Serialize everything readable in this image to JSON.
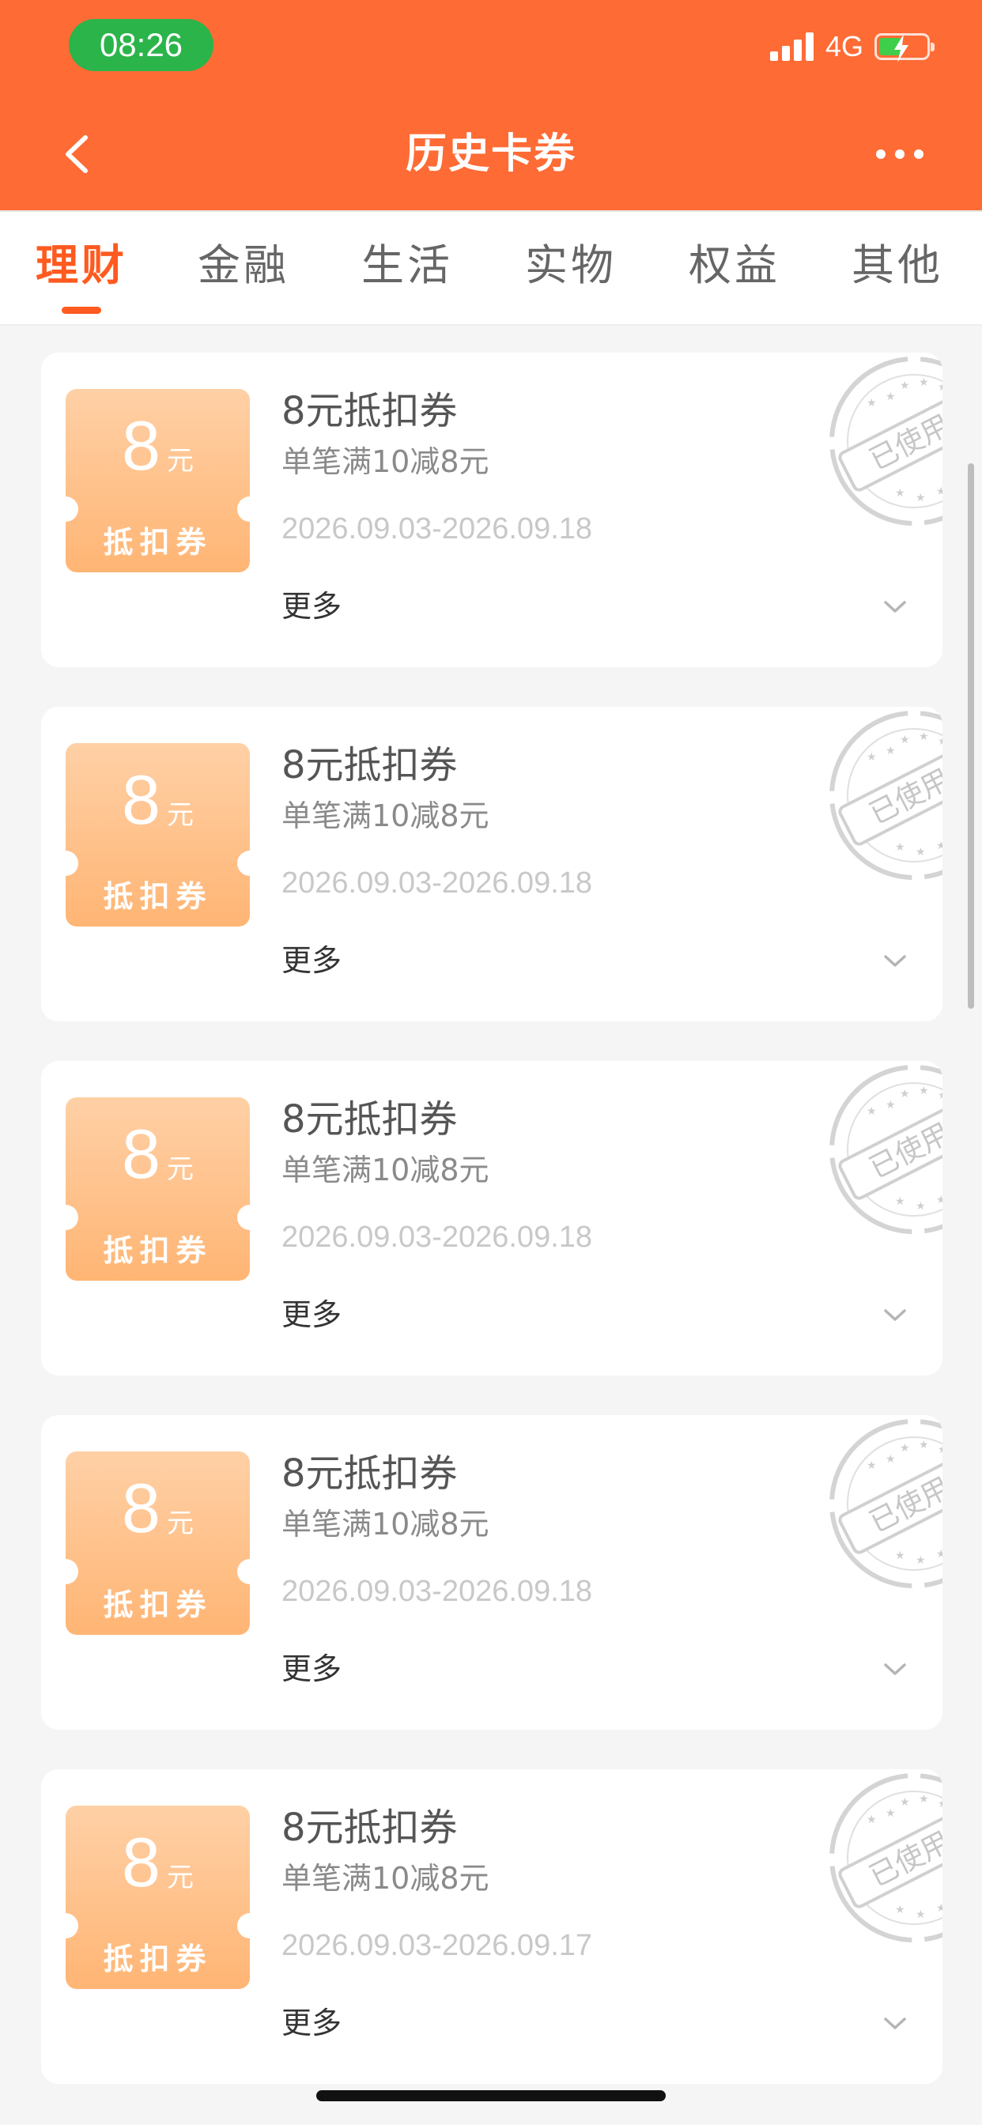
{
  "status_bar": {
    "time": "08:26",
    "network": "4G"
  },
  "header": {
    "title": "历史卡券"
  },
  "tabs": [
    {
      "label": "理财",
      "active": true
    },
    {
      "label": "金融",
      "active": false
    },
    {
      "label": "生活",
      "active": false
    },
    {
      "label": "实物",
      "active": false
    },
    {
      "label": "权益",
      "active": false
    },
    {
      "label": "其他",
      "active": false
    }
  ],
  "coupons": [
    {
      "amount": "8",
      "unit": "元",
      "kind": "抵扣券",
      "title": "8元抵扣券",
      "rule": "单笔满10减8元",
      "validity": "2026.09.03-2026.09.18",
      "more": "更多",
      "stamp": "已使用"
    },
    {
      "amount": "8",
      "unit": "元",
      "kind": "抵扣券",
      "title": "8元抵扣券",
      "rule": "单笔满10减8元",
      "validity": "2026.09.03-2026.09.18",
      "more": "更多",
      "stamp": "已使用"
    },
    {
      "amount": "8",
      "unit": "元",
      "kind": "抵扣券",
      "title": "8元抵扣券",
      "rule": "单笔满10减8元",
      "validity": "2026.09.03-2026.09.18",
      "more": "更多",
      "stamp": "已使用"
    },
    {
      "amount": "8",
      "unit": "元",
      "kind": "抵扣券",
      "title": "8元抵扣券",
      "rule": "单笔满10减8元",
      "validity": "2026.09.03-2026.09.18",
      "more": "更多",
      "stamp": "已使用"
    },
    {
      "amount": "8",
      "unit": "元",
      "kind": "抵扣券",
      "title": "8元抵扣券",
      "rule": "单笔满10减8元",
      "validity": "2026.09.03-2026.09.17",
      "more": "更多",
      "stamp": "已使用"
    }
  ],
  "colors": {
    "header": "#ff6b35",
    "accent": "#ff5a1f",
    "coupon": "#ffb574",
    "background": "#f5f5f5"
  },
  "icons": [
    "back-arrow-icon",
    "more-dots-icon",
    "signal-icon",
    "battery-icon",
    "chevron-down-icon",
    "used-stamp-icon"
  ]
}
